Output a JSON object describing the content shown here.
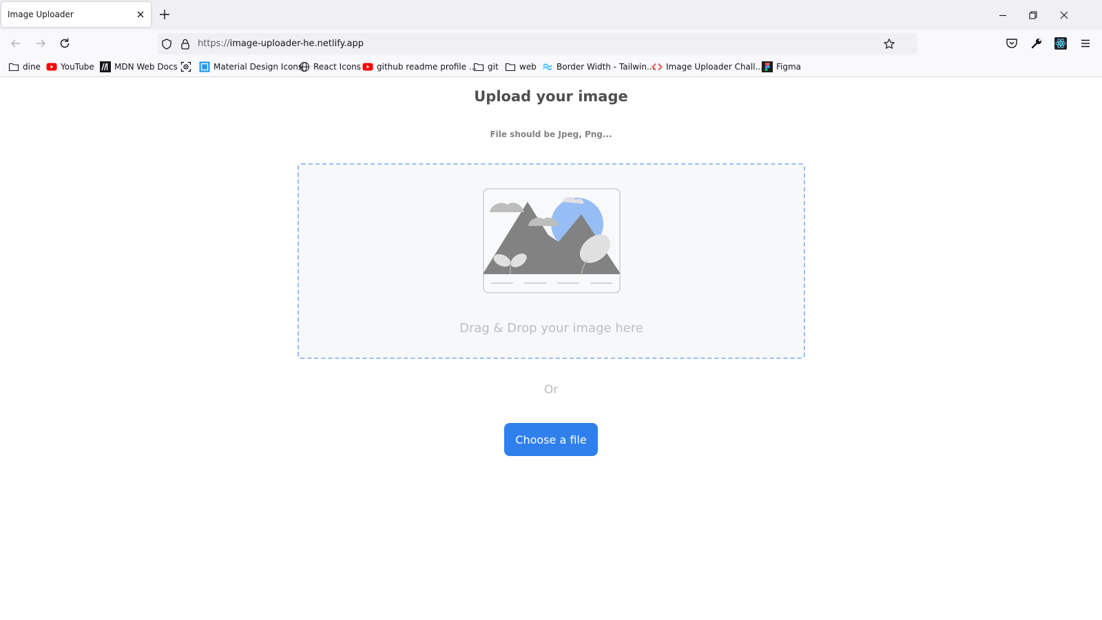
{
  "browser": {
    "tab_title": "Image Uploader",
    "url_scheme": "https://",
    "url_rest": "image-uploader-he.netlify.app"
  },
  "bookmarks": [
    {
      "label": "dine",
      "icon": "folder-icon"
    },
    {
      "label": "YouTube",
      "icon": "youtube-icon"
    },
    {
      "label": "MDN Web Docs",
      "icon": "mdn-icon"
    },
    {
      "label": "",
      "icon": "screenshot-icon"
    },
    {
      "label": "Material Design Icons",
      "icon": "material-design-icon"
    },
    {
      "label": "React Icons",
      "icon": "globe-icon"
    },
    {
      "label": "github readme profile ...",
      "icon": "youtube-icon"
    },
    {
      "label": "git",
      "icon": "folder-icon"
    },
    {
      "label": "web",
      "icon": "folder-icon"
    },
    {
      "label": "Border Width - Tailwin...",
      "icon": "tailwind-icon"
    },
    {
      "label": "Image Uploader Chall...",
      "icon": "devchallenges-icon"
    },
    {
      "label": "Figma",
      "icon": "figma-icon"
    }
  ],
  "page": {
    "title": "Upload your image",
    "subtitle": "File should be Jpeg, Png...",
    "drop_text": "Drag & Drop your image here",
    "or_text": "Or",
    "button_label": "Choose a file"
  },
  "colors": {
    "accent": "#2f80ed",
    "dropzone_border": "#97bef4",
    "dropzone_bg": "#f6f8fb",
    "muted_text": "#bdbdbd"
  }
}
